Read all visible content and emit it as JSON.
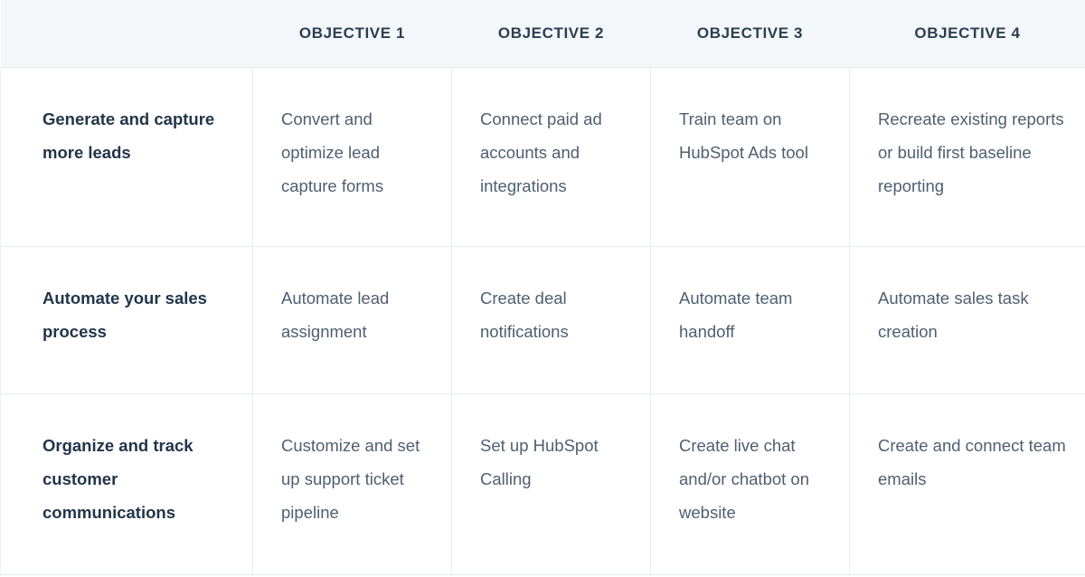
{
  "table": {
    "header": {
      "corner_label": "",
      "columns": [
        "OBJECTIVE 1",
        "OBJECTIVE 2",
        "OBJECTIVE 3",
        "OBJECTIVE 4"
      ]
    },
    "rows": [
      {
        "goal": "Generate and capture more leads",
        "cells": [
          "Convert and optimize lead capture forms",
          "Connect paid ad accounts and integrations",
          "Train team on HubSpot Ads tool",
          "Recreate existing reports or build first baseline reporting"
        ]
      },
      {
        "goal": "Automate your sales process",
        "cells": [
          "Automate lead assignment",
          "Create deal notifications",
          "Automate team handoff",
          "Automate sales task creation"
        ]
      },
      {
        "goal": "Organize and track customer communications",
        "cells": [
          "Customize and set up support ticket pipeline",
          "Set up HubSpot Calling",
          "Create live chat and/or chatbot on website",
          "Create and connect team emails"
        ]
      }
    ]
  },
  "colors": {
    "header_background": "#f3f7fa",
    "header_text": "#2c3e50",
    "goal_text": "#22354a",
    "body_text": "#4f5f6f",
    "border": "#e6ecef",
    "cell_background": "#ffffff"
  }
}
